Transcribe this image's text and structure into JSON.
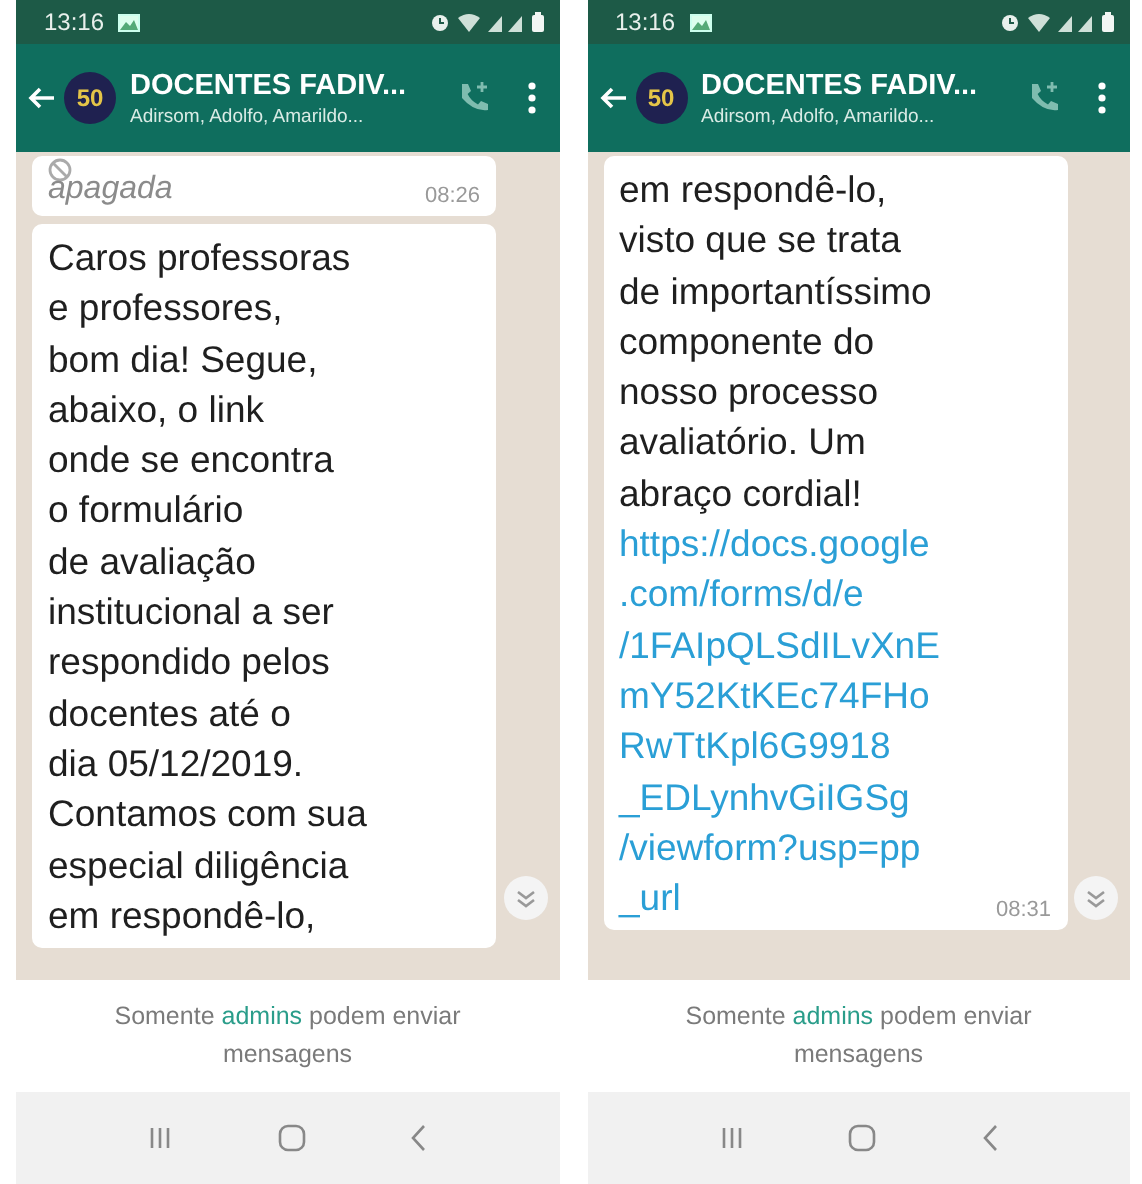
{
  "phones": [
    {
      "status_bar": {
        "time": "13:16"
      },
      "header": {
        "avatar_text": "50",
        "title": "DOCENTES FADIV...",
        "subtitle": "Adirsom, Adolfo, Amarildo..."
      },
      "messages": [
        {
          "kind": "deleted",
          "text": "apagada",
          "time": "08:26"
        },
        {
          "kind": "text",
          "text": "Caros professoras\ne professores,\nbom dia! Segue,\nabaixo, o link\nonde se encontra\no formulário\nde avaliação\ninstitucional a ser\nrespondido pelos\ndocentes até o\ndia 05/12/2019.\nContamos com sua\nespecial diligência\nem respondê-lo,"
        }
      ],
      "notice": {
        "before": "Somente ",
        "link": "admins",
        "after": " podem enviar mensagens"
      }
    },
    {
      "status_bar": {
        "time": "13:16"
      },
      "header": {
        "avatar_text": "50",
        "title": "DOCENTES FADIV...",
        "subtitle": "Adirsom, Adolfo, Amarildo..."
      },
      "messages": [
        {
          "kind": "text",
          "text": "em respondê-lo,\nvisto que se trata\nde importantíssimo\ncomponente do\nnosso processo\navaliatório. Um\nabraço cordial!",
          "link": "https://docs.google\n.com/forms/d/e\n/1FAIpQLSdILvXnE\nmY52KtKEc74FHo\nRwTtKpl6G9918\n_EDLynhvGiIGSg\n/viewform?usp=pp\n_url",
          "time": "08:31"
        }
      ],
      "notice": {
        "before": "Somente ",
        "link": "admins",
        "after": " podem enviar mensagens"
      }
    }
  ]
}
